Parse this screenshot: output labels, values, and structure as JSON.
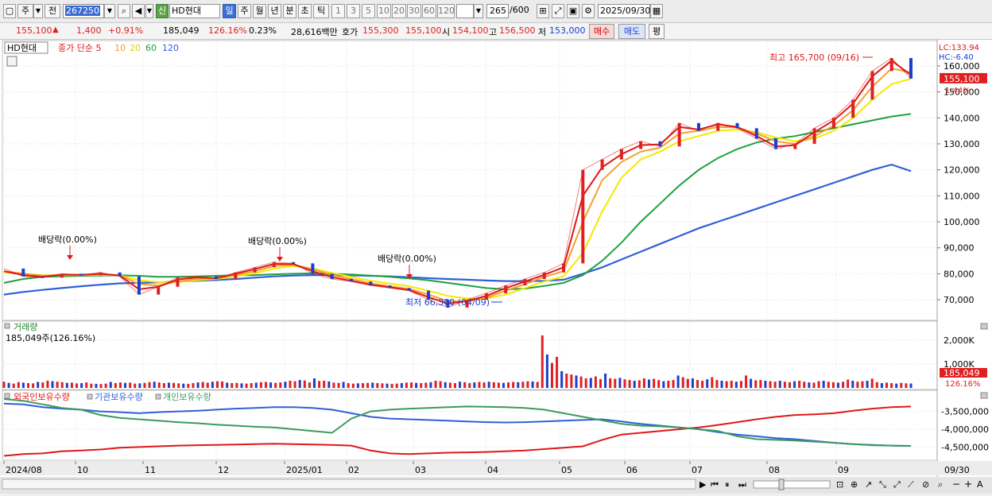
{
  "toolbar": {
    "period_main": "주",
    "period_prev": "전",
    "code": "267250",
    "stock_badge": "신",
    "stock_name": "HD현대",
    "periods": [
      "일",
      "주",
      "월",
      "년",
      "분",
      "초",
      "틱"
    ],
    "active_period": "일",
    "minute_options": [
      "1",
      "3",
      "5",
      "10",
      "20",
      "30",
      "60",
      "120"
    ],
    "count": "265",
    "count_total": "/600",
    "date": "2025/09/30"
  },
  "quote": {
    "price": "155,100",
    "change": "1,400",
    "change_pct": "+0.91%",
    "volume": "185,049",
    "volume_ratio": "126.16%",
    "turnover_pct": "0.23%",
    "amount": "28,616백만",
    "ask_label": "호가",
    "ask_1": "155,300",
    "ask_2": "155,100",
    "open_label": "시",
    "open": "154,100",
    "high_label": "고",
    "high": "156,500",
    "low_label": "저",
    "low": "153,000",
    "buy_label": "매수",
    "sell_label": "매도",
    "eval_label": "평"
  },
  "colors": {
    "up": "#e02020",
    "down": "#1a3fd0",
    "ma5": "#e01818",
    "ma10": "#f0a030",
    "ma20": "#f5e800",
    "ma60": "#20a040",
    "ma120": "#3060d8",
    "foreign": "#e01818",
    "institution": "#3060d8",
    "individual": "#3c9a60"
  },
  "chart_data": [
    {
      "type": "line",
      "title": "HD현대",
      "legend": [
        "종가 단순 5",
        "10",
        "20",
        "60",
        "120"
      ],
      "x_ticks": [
        "2024/08",
        "10",
        "11",
        "12",
        "2025/01",
        "02",
        "03",
        "04",
        "05",
        "06",
        "07",
        "08",
        "09",
        "09/30"
      ],
      "y_ticks": [
        70000,
        80000,
        90000,
        100000,
        110000,
        120000,
        130000,
        140000,
        150000,
        160000
      ],
      "y_tick_labels": [
        "70,000",
        "80,000",
        "90,000",
        "100,000",
        "110,000",
        "120,000",
        "130,000",
        "140,000",
        "150,000",
        "160,000"
      ],
      "ylim": [
        63000,
        167000
      ],
      "lc": "LC:133.94",
      "hc": "HC:-6.40",
      "last_price_label": "155,100",
      "last_pct_label": "1.44%",
      "annotations": [
        {
          "text": "최고 165,700 (09/16)",
          "value": 165700
        },
        {
          "text": "최저 66,300 (04/09)",
          "value": 66300
        },
        {
          "text": "배당락(0.00%)",
          "date": "2024/09"
        },
        {
          "text": "배당락(0.00%)",
          "date": "2024/12"
        },
        {
          "text": "배당락(0.00%)",
          "date": "2025/03"
        }
      ],
      "series": [
        {
          "name": "종가",
          "values": [
            82000,
            79000,
            78500,
            80000,
            79500,
            80500,
            79000,
            72000,
            75000,
            78500,
            79000,
            78000,
            80500,
            82500,
            84500,
            84000,
            80000,
            78000,
            77000,
            75500,
            74500,
            73500,
            70000,
            67000,
            70000,
            72500,
            75500,
            78000,
            80500,
            84000,
            120000,
            124000,
            128000,
            131000,
            129000,
            138000,
            135000,
            138000,
            136000,
            132000,
            128000,
            130000,
            136000,
            140000,
            147000,
            158000,
            163000,
            155100
          ]
        },
        {
          "name": "5",
          "values": [
            81000,
            79500,
            78800,
            79700,
            79600,
            80000,
            79300,
            74000,
            75000,
            77800,
            78600,
            78300,
            80000,
            81800,
            83800,
            83700,
            81000,
            78700,
            77300,
            75800,
            74800,
            73700,
            71000,
            68500,
            69500,
            71500,
            74500,
            77000,
            79600,
            82500,
            110000,
            121000,
            126000,
            129500,
            129800,
            136500,
            135500,
            137500,
            136500,
            133000,
            129000,
            129500,
            134500,
            139000,
            145500,
            156000,
            162000,
            156500
          ]
        },
        {
          "name": "10",
          "values": [
            81000,
            80000,
            79200,
            79500,
            79600,
            79800,
            79500,
            76000,
            75500,
            77000,
            78000,
            78300,
            79500,
            81000,
            83000,
            83500,
            81800,
            79500,
            78000,
            76300,
            75200,
            74200,
            72000,
            69500,
            69300,
            70800,
            73500,
            76000,
            78800,
            81000,
            100000,
            116000,
            123000,
            127000,
            128500,
            134000,
            135000,
            136500,
            136300,
            134000,
            131000,
            130000,
            133000,
            137000,
            143000,
            152000,
            159000,
            157500
          ]
        },
        {
          "name": "20",
          "values": [
            80500,
            80000,
            79500,
            79400,
            79500,
            79600,
            79400,
            77500,
            76800,
            76800,
            77500,
            78000,
            79000,
            80200,
            82000,
            83000,
            82000,
            80300,
            78800,
            77300,
            76200,
            75200,
            73500,
            71500,
            70500,
            70500,
            72000,
            74500,
            77000,
            79000,
            88000,
            104000,
            117000,
            124000,
            127000,
            131000,
            133000,
            135000,
            135500,
            134500,
            132500,
            131000,
            132000,
            135000,
            140000,
            147000,
            153000,
            155000
          ]
        },
        {
          "name": "60",
          "values": [
            76500,
            78000,
            78800,
            79000,
            79200,
            79300,
            79400,
            79200,
            78800,
            78800,
            79000,
            79200,
            79400,
            79500,
            79800,
            80000,
            80200,
            80000,
            79700,
            79300,
            78800,
            78200,
            77500,
            76500,
            75500,
            74500,
            74000,
            74300,
            75300,
            76500,
            79500,
            85000,
            92000,
            100000,
            107000,
            114000,
            120000,
            124500,
            128000,
            130500,
            132000,
            133000,
            134500,
            136000,
            137500,
            139000,
            140500,
            141500
          ]
        },
        {
          "name": "120",
          "values": [
            72000,
            73000,
            73800,
            74500,
            75200,
            75800,
            76300,
            76500,
            76700,
            77000,
            77300,
            77600,
            78000,
            78500,
            79000,
            79300,
            79500,
            79500,
            79400,
            79200,
            79000,
            78700,
            78300,
            78000,
            77700,
            77400,
            77200,
            77100,
            77300,
            77700,
            80000,
            82500,
            85500,
            88500,
            91500,
            94500,
            97500,
            100000,
            102500,
            105000,
            107500,
            110000,
            112500,
            115000,
            117500,
            120000,
            122000,
            119500
          ]
        }
      ]
    },
    {
      "type": "bar",
      "title": "거래량",
      "value_label": "185,049주(126.16%)",
      "y_tick_labels": [
        "1,000K",
        "2,000K"
      ],
      "last_label": "185,049",
      "last_pct_label": "126.16%",
      "values": [
        260,
        210,
        180,
        240,
        220,
        200,
        190,
        250,
        230,
        300,
        280,
        260,
        240,
        210,
        220,
        190,
        200,
        230,
        180,
        170,
        160,
        180,
        250,
        200,
        230,
        210,
        220,
        180,
        190,
        210,
        240,
        260,
        230,
        200,
        220,
        210,
        190,
        180,
        170,
        200,
        230,
        250,
        220,
        260,
        280,
        270,
        220,
        200,
        210,
        190,
        180,
        200,
        220,
        240,
        250,
        230,
        210,
        230,
        260,
        300,
        280,
        330,
        310,
        230,
        400,
        290,
        300,
        270,
        220,
        210,
        250,
        200,
        180,
        190,
        200,
        210,
        220,
        200,
        190,
        180,
        170,
        180,
        200,
        220,
        230,
        210,
        200,
        220,
        240,
        300,
        280,
        240,
        220,
        200,
        260,
        240,
        200,
        230,
        250,
        230,
        260,
        240,
        220,
        210,
        230,
        250,
        240,
        260,
        280,
        270,
        250,
        2200,
        1400,
        1050,
        1300,
        700,
        600,
        560,
        520,
        480,
        400,
        420,
        480,
        370,
        600,
        400,
        380,
        420,
        360,
        330,
        300,
        320,
        400,
        350,
        380,
        330,
        280,
        300,
        330,
        520,
        450,
        380,
        400,
        330,
        300,
        360,
        450,
        330,
        300,
        280,
        300,
        260,
        290,
        520,
        380,
        320,
        330,
        300,
        280,
        260,
        300,
        260,
        240,
        280,
        300,
        260,
        230,
        220,
        280,
        300,
        260,
        240,
        220,
        260,
        350,
        300,
        260,
        280,
        300,
        390,
        240,
        200,
        220,
        200,
        180,
        210,
        190,
        185
      ]
    },
    {
      "type": "line",
      "title": "외국인보유수량",
      "legend": [
        "외국인보유수량",
        "기관보유수량",
        "개인보유수량"
      ],
      "y_tick_labels": [
        "-3,500,000",
        "-4,000,000",
        "-4,500,000"
      ],
      "ylim": [
        -4850000,
        -3150000
      ],
      "series": [
        {
          "name": "외국인보유수량",
          "values": [
            -4750000,
            -4700000,
            -4680000,
            -4620000,
            -4600000,
            -4570000,
            -4520000,
            -4500000,
            -4480000,
            -4460000,
            -4450000,
            -4440000,
            -4430000,
            -4420000,
            -4410000,
            -4420000,
            -4430000,
            -4440000,
            -4460000,
            -4600000,
            -4680000,
            -4700000,
            -4680000,
            -4660000,
            -4650000,
            -4640000,
            -4620000,
            -4600000,
            -4560000,
            -4520000,
            -4480000,
            -4300000,
            -4150000,
            -4100000,
            -4050000,
            -4000000,
            -3950000,
            -3880000,
            -3800000,
            -3720000,
            -3650000,
            -3600000,
            -3580000,
            -3550000,
            -3480000,
            -3420000,
            -3380000,
            -3360000
          ]
        },
        {
          "name": "기관보유수량",
          "values": [
            -3280000,
            -3300000,
            -3380000,
            -3420000,
            -3450000,
            -3500000,
            -3520000,
            -3550000,
            -3520000,
            -3500000,
            -3480000,
            -3450000,
            -3420000,
            -3400000,
            -3380000,
            -3380000,
            -3400000,
            -3450000,
            -3550000,
            -3650000,
            -3700000,
            -3720000,
            -3740000,
            -3760000,
            -3780000,
            -3800000,
            -3810000,
            -3800000,
            -3780000,
            -3760000,
            -3740000,
            -3720000,
            -3780000,
            -3850000,
            -3900000,
            -3950000,
            -4000000,
            -4080000,
            -4150000,
            -4200000,
            -4250000,
            -4280000,
            -4330000,
            -4380000,
            -4420000,
            -4440000,
            -4460000,
            -4470000
          ]
        },
        {
          "name": "개인보유수량",
          "values": [
            -3150000,
            -3200000,
            -3300000,
            -3400000,
            -3450000,
            -3600000,
            -3680000,
            -3720000,
            -3760000,
            -3800000,
            -3830000,
            -3870000,
            -3900000,
            -3930000,
            -3950000,
            -4000000,
            -4050000,
            -4100000,
            -3700000,
            -3500000,
            -3450000,
            -3420000,
            -3400000,
            -3380000,
            -3360000,
            -3370000,
            -3380000,
            -3400000,
            -3450000,
            -3550000,
            -3650000,
            -3750000,
            -3850000,
            -3900000,
            -3920000,
            -3950000,
            -4000000,
            -4050000,
            -4200000,
            -4280000,
            -4300000,
            -4320000,
            -4350000,
            -4380000,
            -4420000,
            -4450000,
            -4460000,
            -4470000
          ]
        }
      ]
    }
  ]
}
